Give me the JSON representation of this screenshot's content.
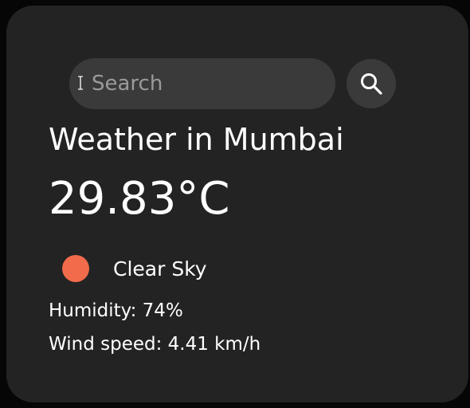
{
  "search": {
    "placeholder": "Search",
    "value": "",
    "button_icon": "search-icon"
  },
  "weather": {
    "title": "Weather in Mumbai",
    "temperature": "29.83°C",
    "condition": "Clear Sky",
    "condition_icon": "sun-icon",
    "condition_color": "#f26b4b",
    "humidity": "Humidity: 74%",
    "wind": "Wind speed: 4.41 km/h"
  },
  "colors": {
    "page_background": "#060606",
    "card_background": "#232323",
    "input_background": "#3a3a3a",
    "text": "#ffffff",
    "placeholder": "#9a9a9a"
  }
}
